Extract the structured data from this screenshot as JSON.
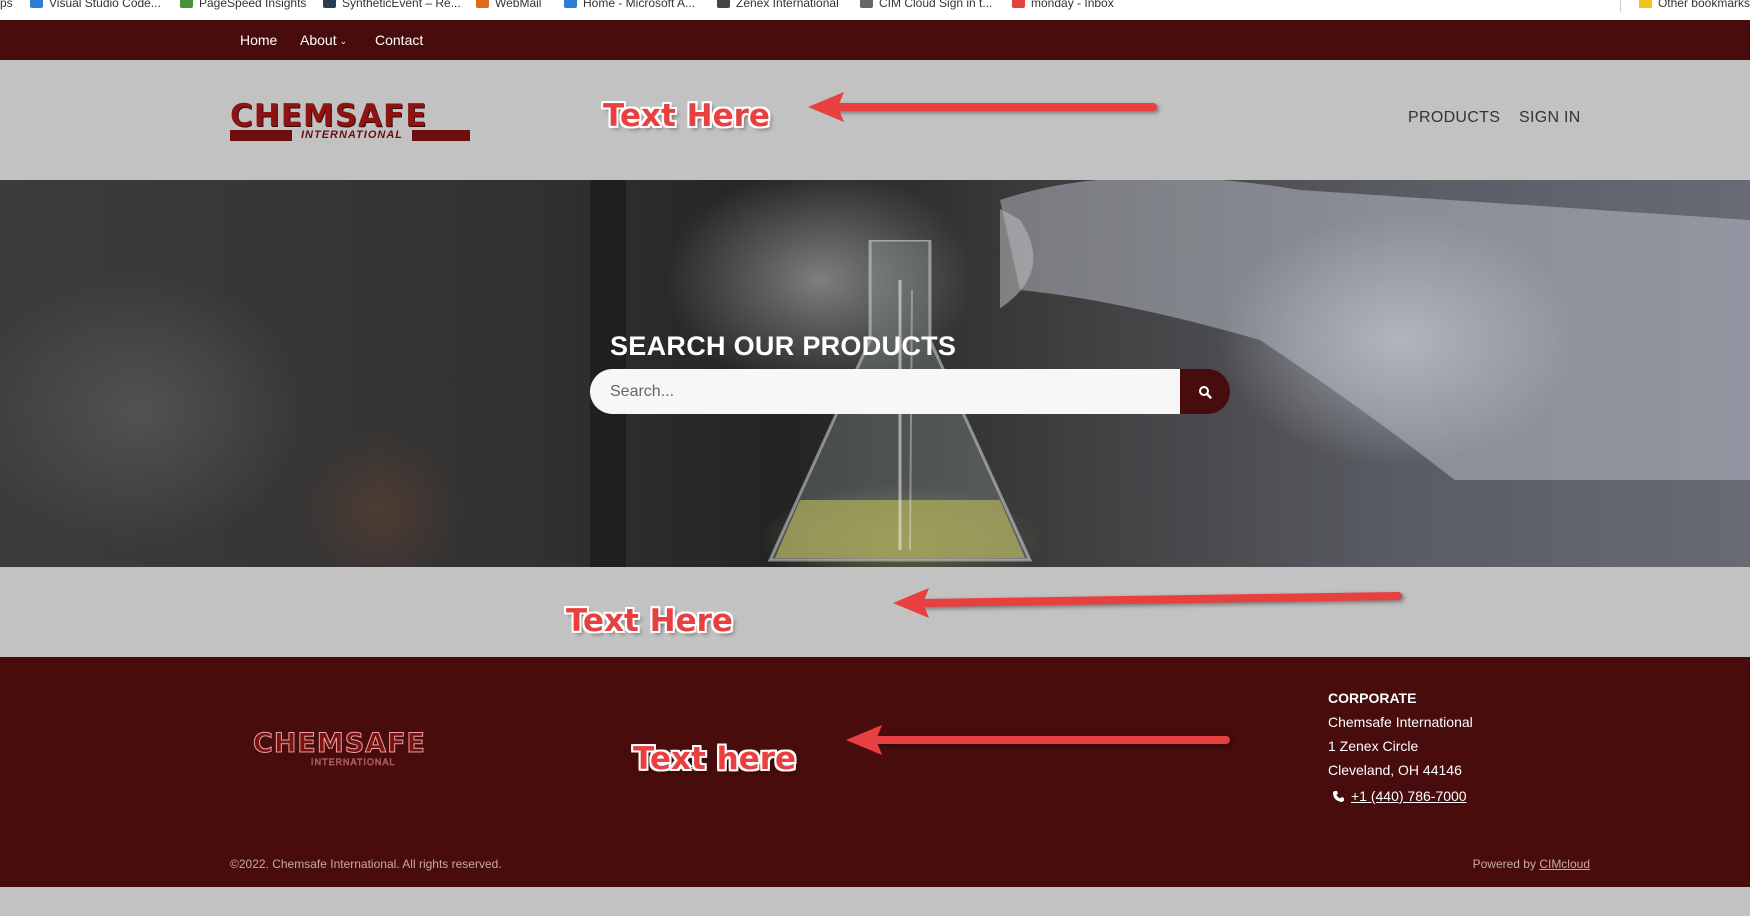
{
  "bookmarks": {
    "items": [
      {
        "label": "ps",
        "color": "#ffffff"
      },
      {
        "label": "Visual Studio Code...",
        "color": "#2a7fd4"
      },
      {
        "label": "PageSpeed Insights",
        "color": "#4a8f3a"
      },
      {
        "label": "SyntheticEvent – Re...",
        "color": "#2b3e50"
      },
      {
        "label": "WebMail",
        "color": "#e06a1b"
      },
      {
        "label": "Home - Microsoft A...",
        "color": "#2a7fd4"
      },
      {
        "label": "Zenex International",
        "color": "#444444"
      },
      {
        "label": "CIM Cloud Sign in t...",
        "color": "#666666"
      },
      {
        "label": "monday - Inbox",
        "color": "#e0433b"
      }
    ],
    "other_label": "Other bookmarks"
  },
  "topnav": {
    "home": "Home",
    "about": "About",
    "contact": "Contact"
  },
  "header": {
    "logo_word": "CHEMSAFE",
    "logo_sub": "INTERNATIONAL",
    "nav_products": "PRODUCTS",
    "nav_signin": "SIGN IN"
  },
  "annotations": {
    "header_note": "Text Here",
    "band_note": "Text Here",
    "footer_note": "Text here",
    "color": "#e84040"
  },
  "hero": {
    "title": "SEARCH OUR PRODUCTS",
    "search_placeholder": "Search..."
  },
  "footer": {
    "logo_word": "CHEMSAFE",
    "logo_sub": "INTERNATIONAL",
    "corporate_heading": "CORPORATE",
    "company": "Chemsafe International",
    "address1": "1 Zenex Circle",
    "address2": "Cleveland, OH 44146",
    "phone": "+1 (440) 786-7000",
    "copyright": "©2022. Chemsafe International. All rights reserved.",
    "powered_prefix": "Powered by",
    "powered_link": "CIMcloud"
  },
  "colors": {
    "brand_dark_red": "#480c0d",
    "header_gray": "#c2c2c2"
  }
}
